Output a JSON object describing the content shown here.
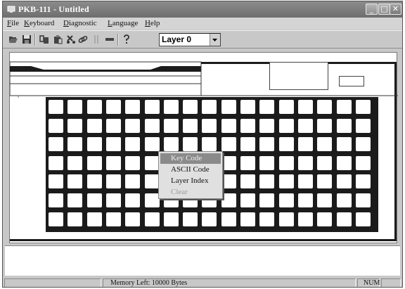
{
  "window": {
    "title": "PKB-111 - Untitled",
    "controls": {
      "minimize": "_",
      "maximize": "□",
      "close": "✕"
    }
  },
  "menu": [
    {
      "label": "File",
      "underline": "F",
      "rest": "ile"
    },
    {
      "label": "Keyboard",
      "underline": "K",
      "rest": "eyboard"
    },
    {
      "label": "Diagnostic",
      "underline": "D",
      "rest": "iagnostic"
    },
    {
      "label": "Language",
      "underline": "L",
      "rest": "anguage"
    },
    {
      "label": "Help",
      "underline": "H",
      "rest": "elp"
    }
  ],
  "toolbar": {
    "icons": [
      "open-folder-icon",
      "save-icon",
      "cut-icon",
      "copy-icon",
      "paste-icon",
      "link-icon",
      "column-icon",
      "row-icon",
      "help-icon"
    ],
    "layer_select": {
      "value": "Layer 0"
    }
  },
  "keyboard": {
    "rows": 7,
    "cols": 17
  },
  "context_menu": {
    "items": [
      {
        "label": "Key Code",
        "state": "highlighted"
      },
      {
        "label": "ASCII Code",
        "state": "normal"
      },
      {
        "label": "Layer Index",
        "state": "normal"
      },
      {
        "label": "Clear",
        "state": "disabled"
      }
    ]
  },
  "status": {
    "memory": "Memory Left: 10000 Bytes",
    "num": "NUM"
  }
}
